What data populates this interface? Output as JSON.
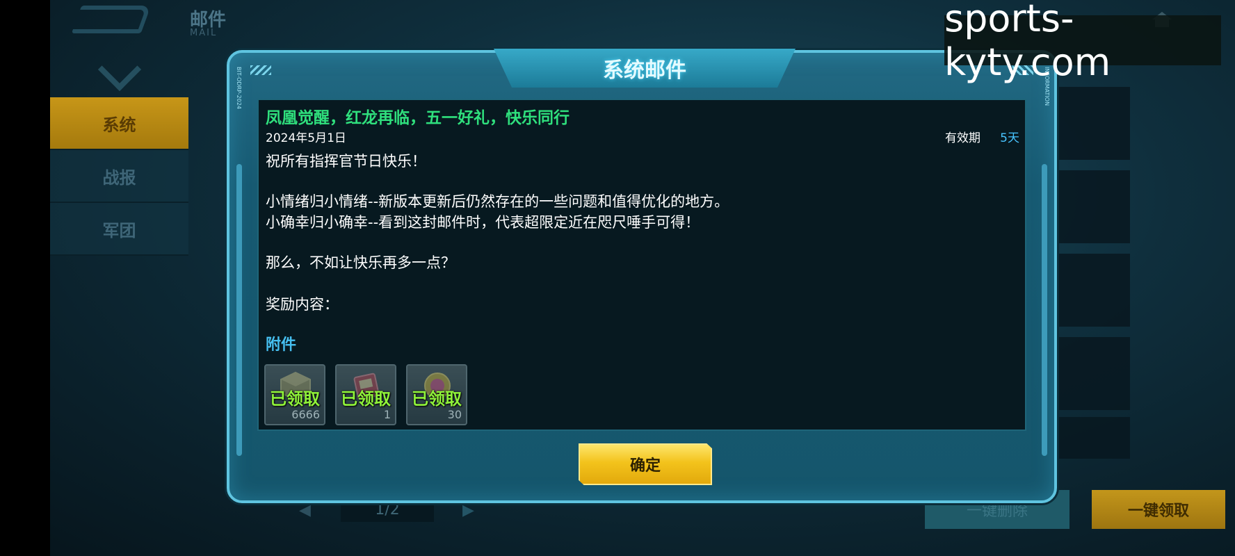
{
  "header": {
    "title": "邮件",
    "subtitle": "MAIL"
  },
  "sidebar": {
    "items": [
      {
        "label": "系统",
        "active": true
      },
      {
        "label": "战报",
        "active": false
      },
      {
        "label": "军团",
        "active": false
      }
    ]
  },
  "background": {
    "pager": "1/2",
    "delete_all_label": "一键删除",
    "claim_all_label": "一键领取"
  },
  "watermark": "sports-kyty.com",
  "dialog": {
    "title": "系统邮件",
    "side_text_left": "BIT-ODRP-2024",
    "side_text_right": "INFORMATION",
    "subject": "凤凰觉醒，红龙再临，五一好礼，快乐同行",
    "date": "2024年5月1日",
    "validity_label": "有效期",
    "validity_value": "5天",
    "body": {
      "line1": "祝所有指挥官节日快乐！",
      "line2": "小情绪归小情绪--新版本更新后仍然存在的一些问题和值得优化的地方。",
      "line3": "小确幸归小确幸--看到这封邮件时，代表超限定近在咫尺唾手可得！",
      "line4": "那么，不如让快乐再多一点？",
      "line5": "奖励内容："
    },
    "attachments_label": "附件",
    "attachments": [
      {
        "status": "已领取",
        "count": "6666",
        "icon": "crate-icon"
      },
      {
        "status": "已领取",
        "count": "1",
        "icon": "card-icon"
      },
      {
        "status": "已领取",
        "count": "30",
        "icon": "medal-icon"
      }
    ],
    "confirm_label": "确定"
  },
  "colors": {
    "subject": "#2fe07d",
    "validity": "#48c4ff",
    "attachments_label": "#46bff0",
    "claimed": "#8ff23a",
    "confirm": "#f3c31c",
    "sidebar_active": "#c79618"
  }
}
